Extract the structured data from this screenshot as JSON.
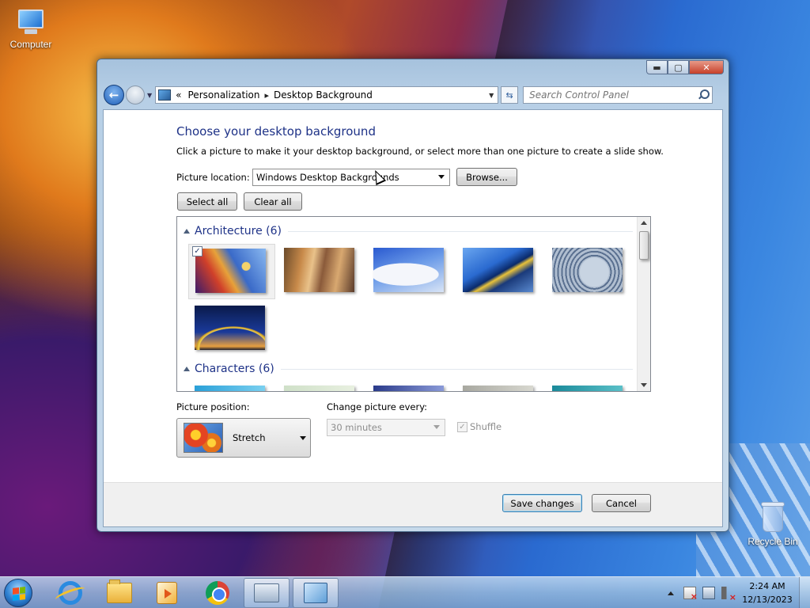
{
  "desktop": {
    "computer_label": "Computer",
    "recycle_bin_label": "Recycle Bin"
  },
  "window": {
    "buttons": {
      "minimize": "▬",
      "maximize": "▢",
      "close": "✕"
    },
    "address": {
      "history_chevron": "«",
      "crumbs": [
        "Personalization",
        "Desktop Background"
      ],
      "separator": "▸"
    },
    "search_placeholder": "Search Control Panel",
    "heading": "Choose your desktop background",
    "description": "Click a picture to make it your desktop background, or select more than one picture to create a slide show.",
    "picture_location_label": "Picture location:",
    "picture_location_value": "Windows Desktop Backgrounds",
    "browse_label": "Browse...",
    "select_all_label": "Select all",
    "clear_all_label": "Clear all",
    "groups": [
      {
        "title": "Architecture (6)",
        "selected_index": 0
      },
      {
        "title": "Characters (6)"
      }
    ],
    "picture_position_label": "Picture position:",
    "picture_position_value": "Stretch",
    "change_every_label": "Change picture every:",
    "change_every_value": "30 minutes",
    "shuffle_label": "Shuffle",
    "save_label": "Save changes",
    "cancel_label": "Cancel"
  },
  "taskbar": {
    "clock_time": "2:24 AM",
    "clock_date": "12/13/2023"
  },
  "colors": {
    "heading": "#1e3287",
    "accent": "#3c7fb1"
  }
}
